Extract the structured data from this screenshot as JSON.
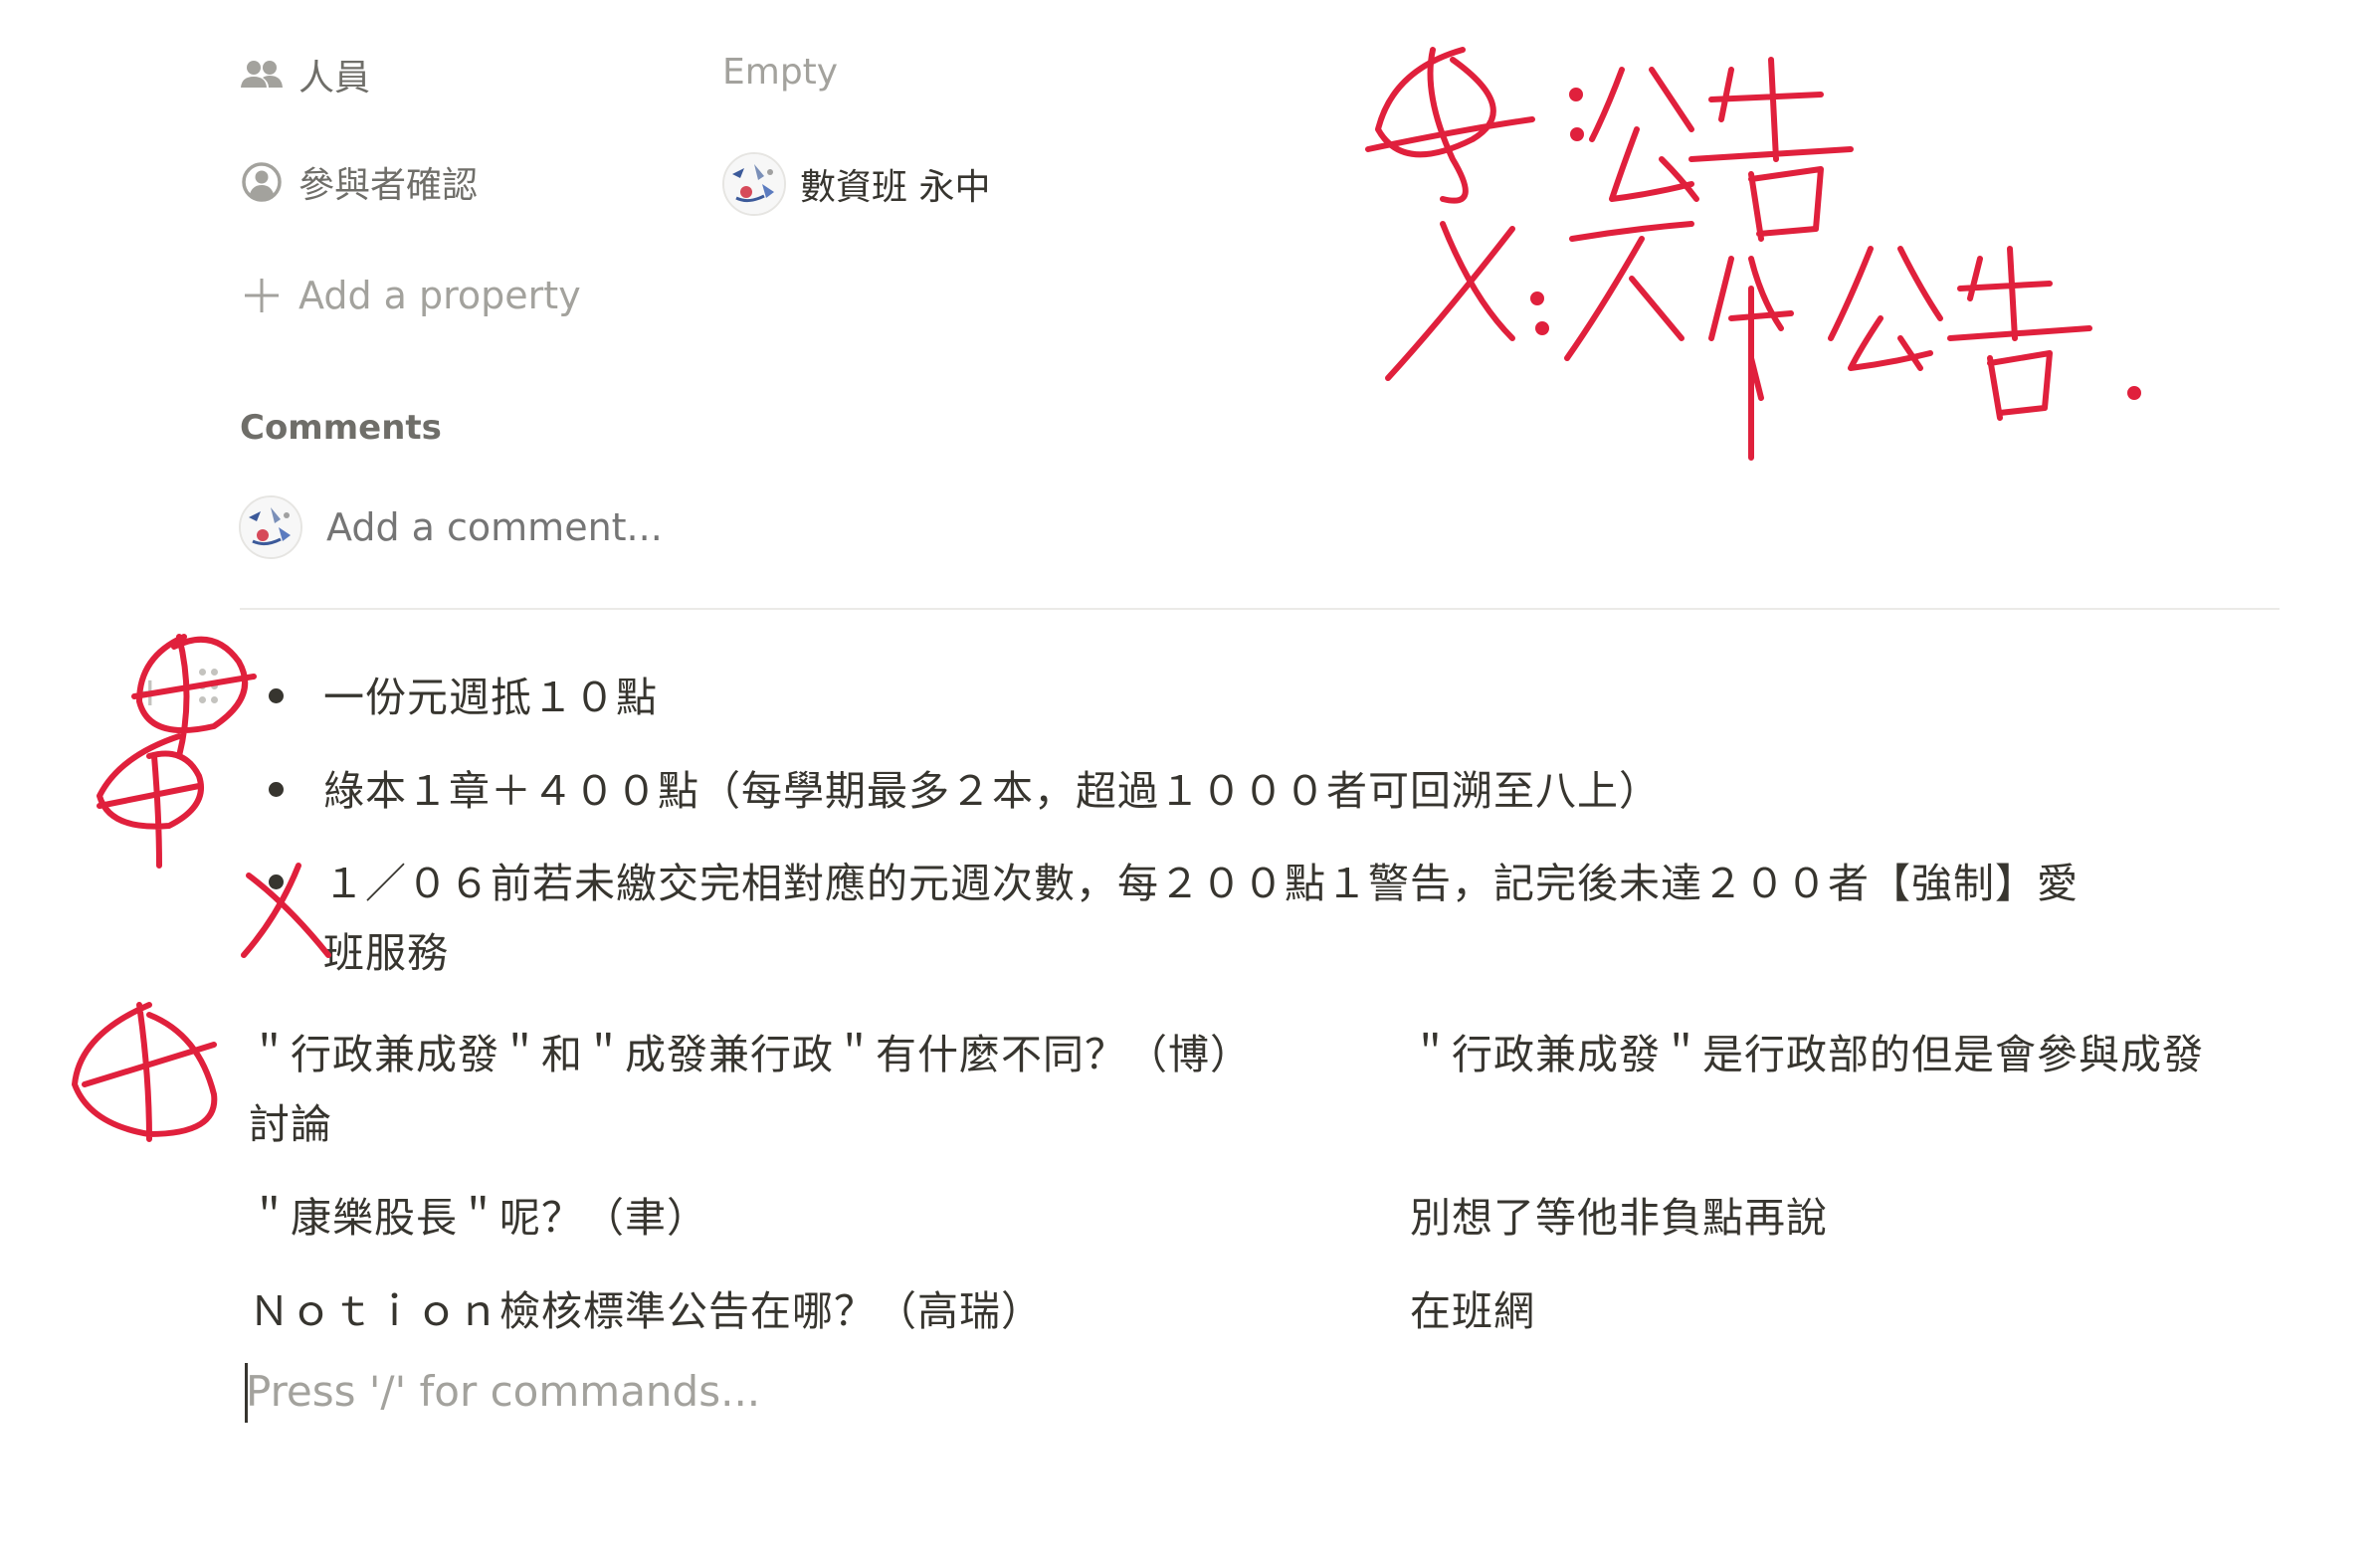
{
  "properties": {
    "people": {
      "label": "人員",
      "value": "Empty"
    },
    "confirmation": {
      "label": "參與者確認",
      "person_name": "數資班 永中"
    },
    "add_property_label": "Add a property"
  },
  "comments": {
    "heading": "Comments",
    "placeholder": "Add a comment..."
  },
  "bullets": [
    "一份元週抵１０點",
    "綠本１章＋４００點（每學期最多２本，超過１０００者可回溯至八上）",
    "１／０６前若未繳交完相對應的元週次數，每２００點１警告，記完後未達２００者【強制】愛",
    "班服務"
  ],
  "qa": [
    {
      "question": "＂行政兼成發＂和＂成發兼行政＂有什麼不同？（博）",
      "answer": "＂行政兼成發＂是行政部的但是會參與成發",
      "answer_cont": "討論"
    },
    {
      "question": "＂康樂股長＂呢？（聿）",
      "answer": "別想了等他非負點再說"
    },
    {
      "question": "Ｎｏｔｉｏｎ檢核標準公告在哪？（高瑞）",
      "answer": "在班網"
    }
  ],
  "editor": {
    "placeholder": "Press '/' for commands..."
  },
  "annotations": {
    "legend_line1": "⊗：公告",
    "legend_line2": "X：不公告."
  },
  "colors": {
    "ink": "#e0203c",
    "text": "#37352f",
    "muted": "#a3a29d"
  }
}
